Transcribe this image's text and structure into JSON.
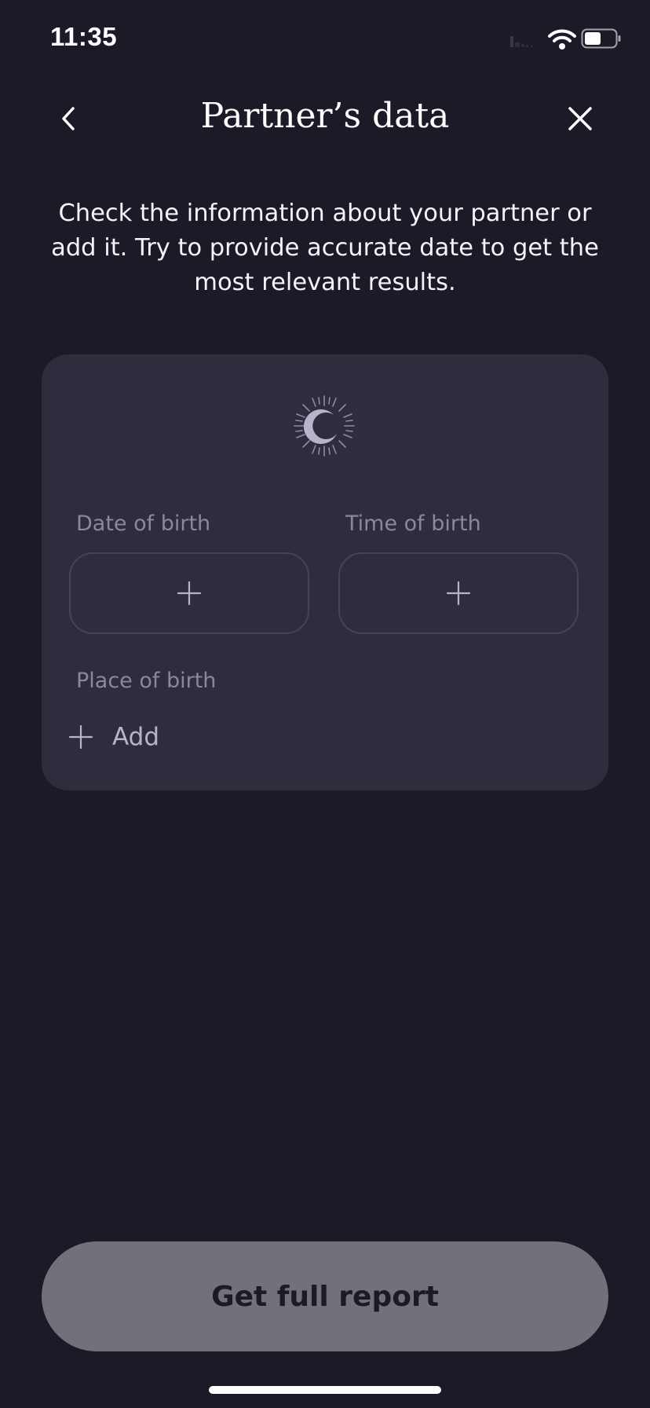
{
  "status_bar": {
    "time": "11:35"
  },
  "header": {
    "title": "Partner’s data"
  },
  "description": "Check the information about your partner or add it. Try to provide accurate date to get the most relevant results.",
  "card": {
    "date_label": "Date of birth",
    "time_label": "Time of birth",
    "place_label": "Place of birth",
    "add_place_label": "Add"
  },
  "cta": {
    "label": "Get full report"
  },
  "colors": {
    "background": "#1b1a27",
    "card": "#2e2d3e",
    "accent": "#b6b3cc",
    "cta_disabled": "#727179"
  },
  "icons": {
    "back": "chevron-left-icon",
    "close": "close-icon",
    "moon": "moon-icon",
    "plus": "plus-icon",
    "wifi": "wifi-icon",
    "battery": "battery-icon",
    "signal": "signal-icon"
  }
}
